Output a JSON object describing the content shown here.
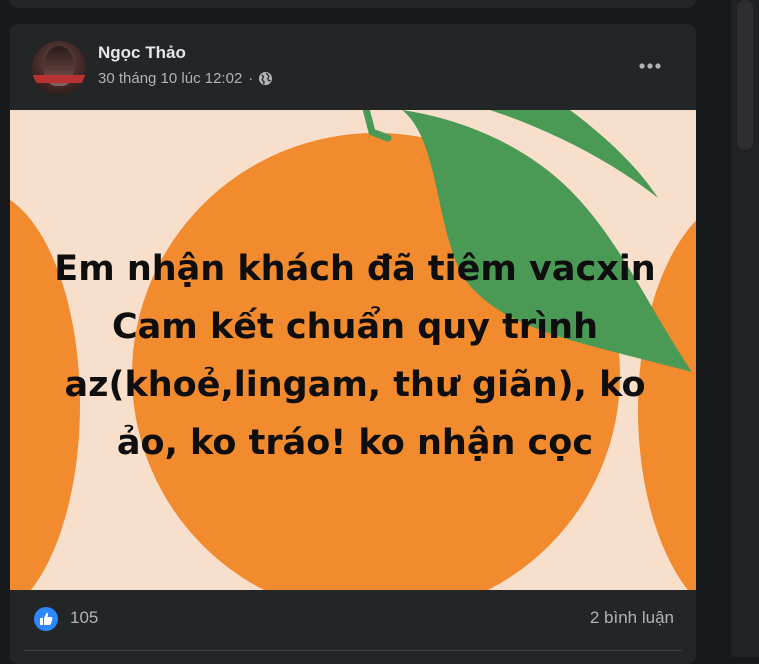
{
  "post": {
    "author_name": "Ngọc Thảo",
    "timestamp": "30 tháng 10 lúc 12:02",
    "separator": "·",
    "privacy_icon": "globe-icon",
    "menu_icon": "more-options-icon",
    "image": {
      "text_lines": [
        "Em nhận khách đã tiêm vacxin",
        "Cam kết chuẩn quy trình",
        "az(khoẻ,lingam, thư giãn), ko",
        "ảo, ko tráo! ko nhận cọc"
      ],
      "background_color": "#f7dfcc",
      "orange_color": "#f28a2e",
      "leaf_color": "#4a9a55"
    },
    "reactions": {
      "icon": "like-icon",
      "count": "105",
      "color": "#2d88ff"
    },
    "comments": "2 bình luận"
  },
  "colors": {
    "page_bg": "#18191a",
    "card_bg": "#242526",
    "primary_text": "#e4e6eb",
    "secondary_text": "#b0b3b8"
  }
}
